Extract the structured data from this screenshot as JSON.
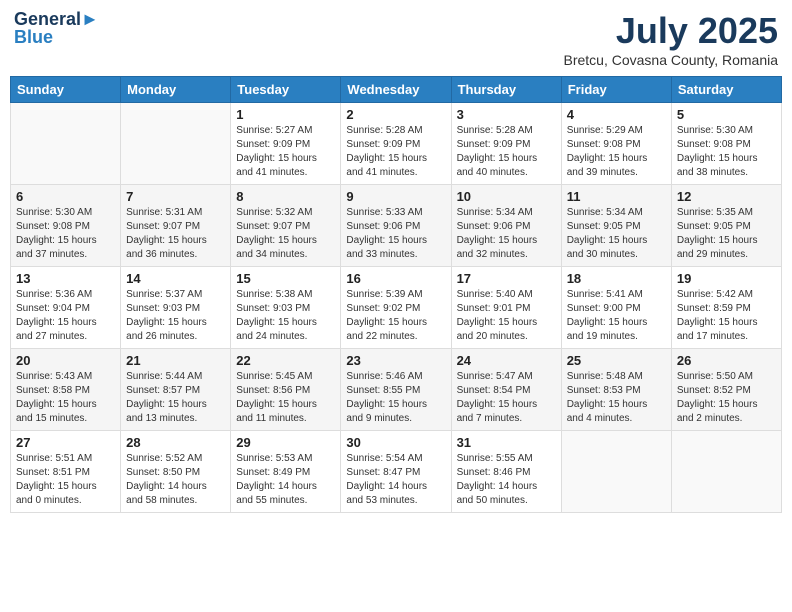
{
  "header": {
    "logo_line1": "General",
    "logo_line2": "Blue",
    "month_year": "July 2025",
    "location": "Bretcu, Covasna County, Romania"
  },
  "weekdays": [
    "Sunday",
    "Monday",
    "Tuesday",
    "Wednesday",
    "Thursday",
    "Friday",
    "Saturday"
  ],
  "weeks": [
    [
      {
        "day": "",
        "info": ""
      },
      {
        "day": "",
        "info": ""
      },
      {
        "day": "1",
        "info": "Sunrise: 5:27 AM\nSunset: 9:09 PM\nDaylight: 15 hours\nand 41 minutes."
      },
      {
        "day": "2",
        "info": "Sunrise: 5:28 AM\nSunset: 9:09 PM\nDaylight: 15 hours\nand 41 minutes."
      },
      {
        "day": "3",
        "info": "Sunrise: 5:28 AM\nSunset: 9:09 PM\nDaylight: 15 hours\nand 40 minutes."
      },
      {
        "day": "4",
        "info": "Sunrise: 5:29 AM\nSunset: 9:08 PM\nDaylight: 15 hours\nand 39 minutes."
      },
      {
        "day": "5",
        "info": "Sunrise: 5:30 AM\nSunset: 9:08 PM\nDaylight: 15 hours\nand 38 minutes."
      }
    ],
    [
      {
        "day": "6",
        "info": "Sunrise: 5:30 AM\nSunset: 9:08 PM\nDaylight: 15 hours\nand 37 minutes."
      },
      {
        "day": "7",
        "info": "Sunrise: 5:31 AM\nSunset: 9:07 PM\nDaylight: 15 hours\nand 36 minutes."
      },
      {
        "day": "8",
        "info": "Sunrise: 5:32 AM\nSunset: 9:07 PM\nDaylight: 15 hours\nand 34 minutes."
      },
      {
        "day": "9",
        "info": "Sunrise: 5:33 AM\nSunset: 9:06 PM\nDaylight: 15 hours\nand 33 minutes."
      },
      {
        "day": "10",
        "info": "Sunrise: 5:34 AM\nSunset: 9:06 PM\nDaylight: 15 hours\nand 32 minutes."
      },
      {
        "day": "11",
        "info": "Sunrise: 5:34 AM\nSunset: 9:05 PM\nDaylight: 15 hours\nand 30 minutes."
      },
      {
        "day": "12",
        "info": "Sunrise: 5:35 AM\nSunset: 9:05 PM\nDaylight: 15 hours\nand 29 minutes."
      }
    ],
    [
      {
        "day": "13",
        "info": "Sunrise: 5:36 AM\nSunset: 9:04 PM\nDaylight: 15 hours\nand 27 minutes."
      },
      {
        "day": "14",
        "info": "Sunrise: 5:37 AM\nSunset: 9:03 PM\nDaylight: 15 hours\nand 26 minutes."
      },
      {
        "day": "15",
        "info": "Sunrise: 5:38 AM\nSunset: 9:03 PM\nDaylight: 15 hours\nand 24 minutes."
      },
      {
        "day": "16",
        "info": "Sunrise: 5:39 AM\nSunset: 9:02 PM\nDaylight: 15 hours\nand 22 minutes."
      },
      {
        "day": "17",
        "info": "Sunrise: 5:40 AM\nSunset: 9:01 PM\nDaylight: 15 hours\nand 20 minutes."
      },
      {
        "day": "18",
        "info": "Sunrise: 5:41 AM\nSunset: 9:00 PM\nDaylight: 15 hours\nand 19 minutes."
      },
      {
        "day": "19",
        "info": "Sunrise: 5:42 AM\nSunset: 8:59 PM\nDaylight: 15 hours\nand 17 minutes."
      }
    ],
    [
      {
        "day": "20",
        "info": "Sunrise: 5:43 AM\nSunset: 8:58 PM\nDaylight: 15 hours\nand 15 minutes."
      },
      {
        "day": "21",
        "info": "Sunrise: 5:44 AM\nSunset: 8:57 PM\nDaylight: 15 hours\nand 13 minutes."
      },
      {
        "day": "22",
        "info": "Sunrise: 5:45 AM\nSunset: 8:56 PM\nDaylight: 15 hours\nand 11 minutes."
      },
      {
        "day": "23",
        "info": "Sunrise: 5:46 AM\nSunset: 8:55 PM\nDaylight: 15 hours\nand 9 minutes."
      },
      {
        "day": "24",
        "info": "Sunrise: 5:47 AM\nSunset: 8:54 PM\nDaylight: 15 hours\nand 7 minutes."
      },
      {
        "day": "25",
        "info": "Sunrise: 5:48 AM\nSunset: 8:53 PM\nDaylight: 15 hours\nand 4 minutes."
      },
      {
        "day": "26",
        "info": "Sunrise: 5:50 AM\nSunset: 8:52 PM\nDaylight: 15 hours\nand 2 minutes."
      }
    ],
    [
      {
        "day": "27",
        "info": "Sunrise: 5:51 AM\nSunset: 8:51 PM\nDaylight: 15 hours\nand 0 minutes."
      },
      {
        "day": "28",
        "info": "Sunrise: 5:52 AM\nSunset: 8:50 PM\nDaylight: 14 hours\nand 58 minutes."
      },
      {
        "day": "29",
        "info": "Sunrise: 5:53 AM\nSunset: 8:49 PM\nDaylight: 14 hours\nand 55 minutes."
      },
      {
        "day": "30",
        "info": "Sunrise: 5:54 AM\nSunset: 8:47 PM\nDaylight: 14 hours\nand 53 minutes."
      },
      {
        "day": "31",
        "info": "Sunrise: 5:55 AM\nSunset: 8:46 PM\nDaylight: 14 hours\nand 50 minutes."
      },
      {
        "day": "",
        "info": ""
      },
      {
        "day": "",
        "info": ""
      }
    ]
  ]
}
